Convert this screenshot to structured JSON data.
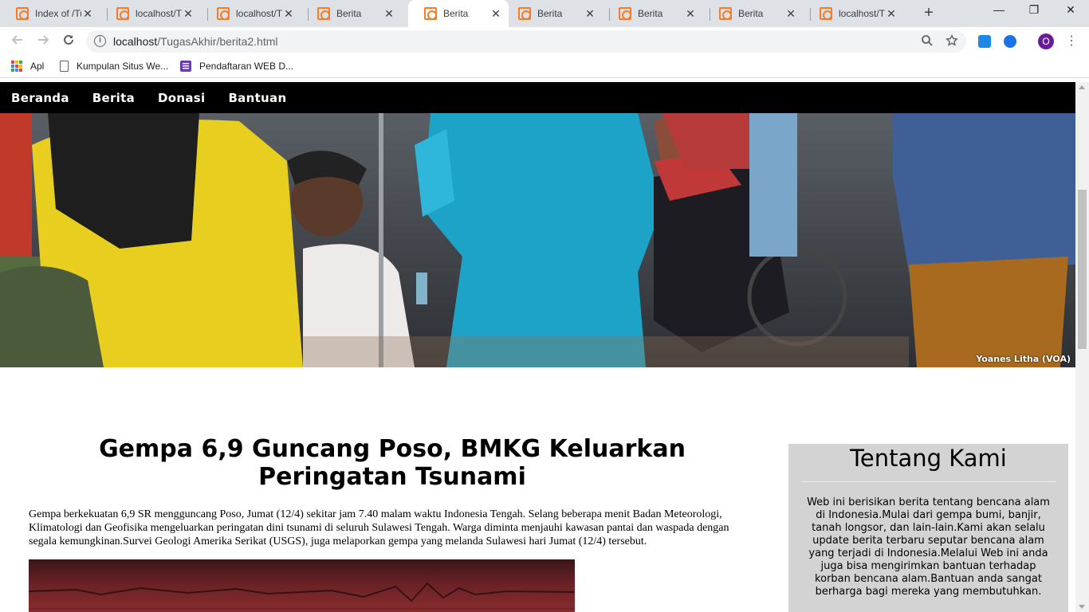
{
  "browser": {
    "tabs": [
      {
        "title": "Index of /Tu",
        "active": false
      },
      {
        "title": "localhost/Tu",
        "active": false
      },
      {
        "title": "localhost/Tu",
        "active": false
      },
      {
        "title": "Berita",
        "active": false
      },
      {
        "title": "Berita",
        "active": true
      },
      {
        "title": "Berita",
        "active": false
      },
      {
        "title": "Berita",
        "active": false
      },
      {
        "title": "Berita",
        "active": false
      },
      {
        "title": "localhost/Tu",
        "active": false
      }
    ],
    "close_glyph": "✕",
    "new_tab_glyph": "+",
    "window_controls": {
      "minimize": "—",
      "restore": "❐",
      "close": "✕"
    },
    "address": {
      "host": "localhost",
      "path": "/TugasAkhir/berita2.html"
    },
    "profile_initial": "O",
    "bookmarks": [
      {
        "label": "Apl",
        "icon": "apps-grid-icon"
      },
      {
        "label": "Kumpulan Situs We...",
        "icon": "page-icon"
      },
      {
        "label": "Pendaftaran WEB D...",
        "icon": "form-icon"
      }
    ]
  },
  "site": {
    "nav": [
      "Beranda",
      "Berita",
      "Donasi",
      "Bantuan"
    ],
    "hero_credit": "Yoanes Litha (VOA)",
    "article": {
      "title": "Gempa 6,9 Guncang Poso, BMKG Keluarkan Peringatan Tsunami",
      "body": "Gempa berkekuatan 6,9 SR mengguncang Poso, Jumat (12/4) sekitar jam 7.40 malam waktu Indonesia Tengah. Selang beberapa menit Badan Meteorologi, Klimatologi dan Geofisika mengeluarkan peringatan dini tsunami di seluruh Sulawesi Tengah. Warga diminta menjauhi kawasan pantai dan waspada dengan segala kemungkinan.Survei Geologi Amerika Serikat (USGS), juga melaporkan gempa yang melanda Sulawesi hari Jumat (12/4) tersebut."
    },
    "aside": {
      "heading": "Tentang Kami",
      "text": "Web ini berisikan berita tentang bencana alam di Indonesia.Mulai dari gempa bumi, banjir, tanah longsor, dan lain-lain.Kami akan selalu update berita terbaru seputar bencana alam yang terjadi di Indonesia.Melalui Web ini anda juga bisa mengirimkan bantuan terhadap korban bencana alam.Bantuan anda sangat berharga bagi mereka yang membutuhkan."
    }
  }
}
